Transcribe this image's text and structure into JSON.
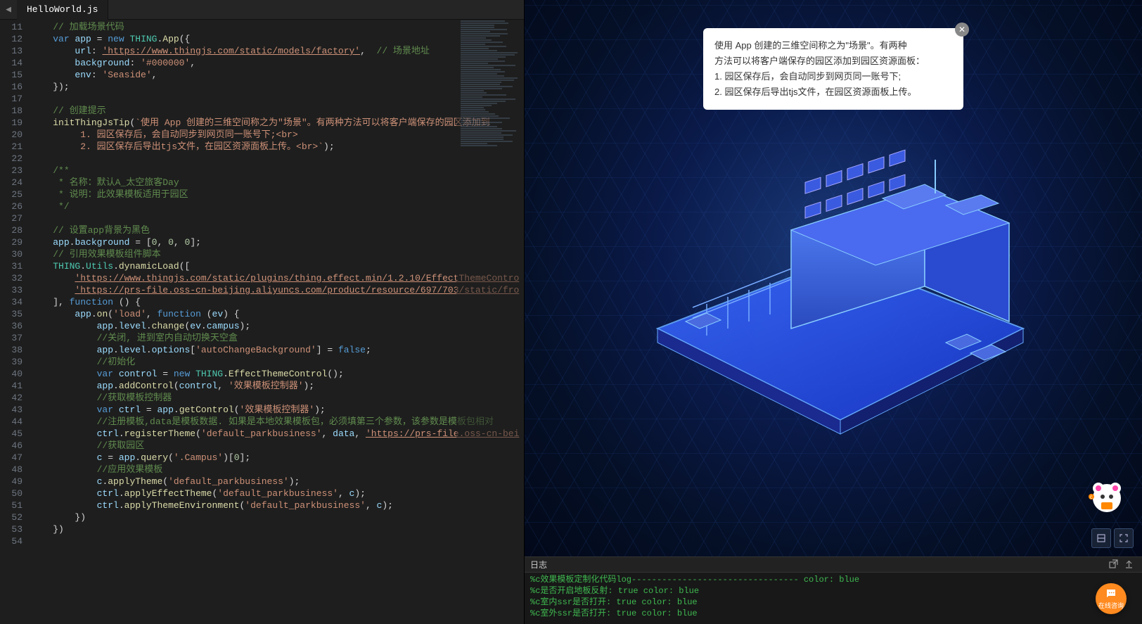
{
  "tab": {
    "filename": "HelloWorld.js"
  },
  "gutter": {
    "start": 11,
    "end": 54
  },
  "code_lines": [
    "    <span class='cm'>// 加载场景代码</span>",
    "    <span class='kw'>var</span> <span class='prop'>app</span> = <span class='kw'>new</span> <span class='cls'>THING</span>.<span class='fn'>App</span>({",
    "        <span class='prop'>url</span>: <span class='url'>'https://www.thingjs.com/static/models/factory'</span>,  <span class='cm'>// 场景地址</span>",
    "        <span class='prop'>background</span>: <span class='str'>'#000000'</span>,",
    "        <span class='prop'>env</span>: <span class='str'>'Seaside'</span>,",
    "    });",
    "",
    "    <span class='cm'>// 创建提示</span>",
    "    <span class='fn'>initThingJsTip</span>(<span class='str'>`使用 App 创建的三维空间称之为\"场景\"。有两种方法可以将客户端保存的园区添加到</span>",
    "         <span class='str'>1. 园区保存后，会自动同步到网页同一账号下;&lt;br&gt;</span>",
    "         <span class='str'>2. 园区保存后导出tjs文件，在园区资源面板上传。&lt;br&gt;`</span>);",
    "",
    "    <span class='cm'>/**</span>",
    "    <span class='cm'> * 名称：默认A_太空旅客Day</span>",
    "    <span class='cm'> * 说明：此效果模板适用于园区</span>",
    "    <span class='cm'> */</span>",
    "",
    "    <span class='cm'>// 设置app背景为黑色</span>",
    "    <span class='prop'>app</span>.<span class='prop'>background</span> = [<span class='num'>0</span>, <span class='num'>0</span>, <span class='num'>0</span>];",
    "    <span class='cm'>// 引用效果模板组件脚本</span>",
    "    <span class='cls'>THING</span>.<span class='cls'>Utils</span>.<span class='fn'>dynamicLoad</span>([",
    "        <span class='url'>'https://www.thingjs.com/static/plugins/thing.effect.min/1.2.10/EffectThemeContro</span>",
    "        <span class='url'>'https://prs-file.oss-cn-beijing.aliyuncs.com/product/resource/697/703/static/fro</span>",
    "    ], <span class='kw'>function</span> () {",
    "        <span class='prop'>app</span>.<span class='fn'>on</span>(<span class='str'>'load'</span>, <span class='kw'>function</span> (<span class='prop'>ev</span>) {",
    "            <span class='prop'>app</span>.<span class='prop'>level</span>.<span class='fn'>change</span>(<span class='prop'>ev</span>.<span class='prop'>campus</span>);",
    "            <span class='cm'>//关闭, 进到室内自动切换天空盒</span>",
    "            <span class='prop'>app</span>.<span class='prop'>level</span>.<span class='prop'>options</span>[<span class='str'>'autoChangeBackground'</span>] = <span class='kw'>false</span>;",
    "            <span class='cm'>//初始化</span>",
    "            <span class='kw'>var</span> <span class='prop'>control</span> = <span class='kw'>new</span> <span class='cls'>THING</span>.<span class='fn'>EffectThemeControl</span>();",
    "            <span class='prop'>app</span>.<span class='fn'>addControl</span>(<span class='prop'>control</span>, <span class='str'>'效果模板控制器'</span>);",
    "            <span class='cm'>//获取模板控制器</span>",
    "            <span class='kw'>var</span> <span class='prop'>ctrl</span> = <span class='prop'>app</span>.<span class='fn'>getControl</span>(<span class='str'>'效果模板控制器'</span>);",
    "            <span class='cm'>//注册模板,data是模板数据. 如果是本地效果模板包，必须填第三个参数，该参数是模板包相对</span>",
    "            <span class='prop'>ctrl</span>.<span class='fn'>registerTheme</span>(<span class='str'>'default_parkbusiness'</span>, <span class='prop'>data</span>, <span class='url'>'https://prs-file.oss-cn-bei</span>",
    "            <span class='cm'>//获取园区</span>",
    "            <span class='prop'>c</span> = <span class='prop'>app</span>.<span class='fn'>query</span>(<span class='str'>'.Campus'</span>)[<span class='num'>0</span>];",
    "            <span class='cm'>//应用效果模板</span>",
    "            <span class='prop'>c</span>.<span class='fn'>applyTheme</span>(<span class='str'>'default_parkbusiness'</span>);",
    "            <span class='prop'>ctrl</span>.<span class='fn'>applyEffectTheme</span>(<span class='str'>'default_parkbusiness'</span>, <span class='prop'>c</span>);",
    "            <span class='prop'>ctrl</span>.<span class='fn'>applyThemeEnvironment</span>(<span class='str'>'default_parkbusiness'</span>, <span class='prop'>c</span>);",
    "        })",
    "    })"
  ],
  "tooltip": {
    "line1": "使用 App 创建的三维空间称之为\"场景\"。有两种",
    "line2": "方法可以将客户端保存的园区添加到园区资源面板：",
    "line3": "1. 园区保存后，会自动同步到网页同一账号下;",
    "line4": "2. 园区保存后导出tjs文件，在园区资源面板上传。"
  },
  "console": {
    "title": "日志",
    "lines": [
      "%c效果模板定制化代码log--------------------------------- color: blue",
      "%c是否开启地板反射:  true color: blue",
      "%c室内ssr是否打开:  true color: blue",
      "%c室外ssr是否打开:  true color: blue"
    ]
  },
  "chat": {
    "label": "在线咨询"
  }
}
